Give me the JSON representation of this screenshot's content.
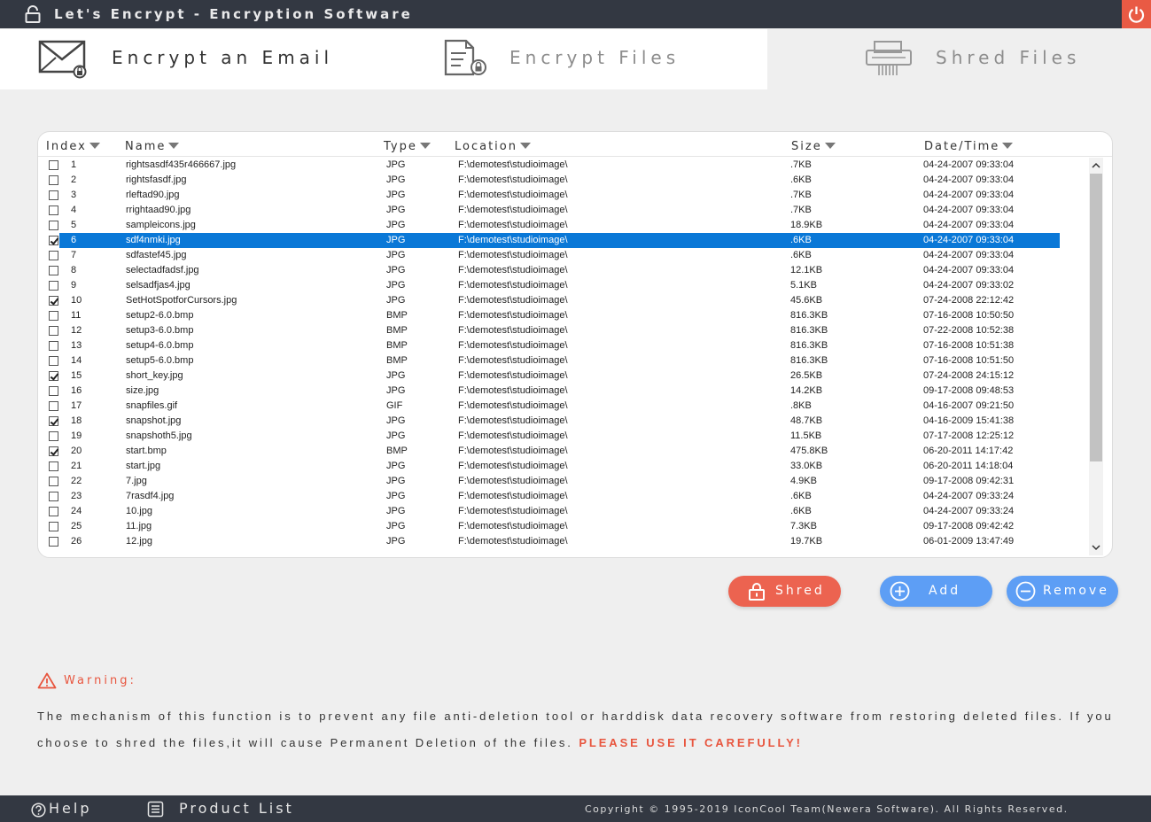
{
  "titlebar": {
    "title": "Let's Encrypt - Encryption Software"
  },
  "tabs": [
    {
      "label": "Encrypt an Email"
    },
    {
      "label": "Encrypt Files"
    },
    {
      "label": "Shred Files"
    }
  ],
  "table": {
    "columns": [
      "Index",
      "Name",
      "Type",
      "Location",
      "Size",
      "Date/Time"
    ],
    "rows": [
      {
        "checked": false,
        "selected": false,
        "index": "1",
        "name": "rightsasdf435r466667.jpg",
        "type": "JPG",
        "location": "F:\\demotest\\studioimage\\",
        "size": ".7KB",
        "date": "04-24-2007  09:33:04"
      },
      {
        "checked": false,
        "selected": false,
        "index": "2",
        "name": "rightsfasdf.jpg",
        "type": "JPG",
        "location": "F:\\demotest\\studioimage\\",
        "size": ".6KB",
        "date": "04-24-2007  09:33:04"
      },
      {
        "checked": false,
        "selected": false,
        "index": "3",
        "name": "rleftad90.jpg",
        "type": "JPG",
        "location": "F:\\demotest\\studioimage\\",
        "size": ".7KB",
        "date": "04-24-2007  09:33:04"
      },
      {
        "checked": false,
        "selected": false,
        "index": "4",
        "name": "rrightaad90.jpg",
        "type": "JPG",
        "location": "F:\\demotest\\studioimage\\",
        "size": ".7KB",
        "date": "04-24-2007  09:33:04"
      },
      {
        "checked": false,
        "selected": false,
        "index": "5",
        "name": "sampleicons.jpg",
        "type": "JPG",
        "location": "F:\\demotest\\studioimage\\",
        "size": "18.9KB",
        "date": "04-24-2007  09:33:04"
      },
      {
        "checked": true,
        "selected": true,
        "index": "6",
        "name": "sdf4nmki.jpg",
        "type": "JPG",
        "location": "F:\\demotest\\studioimage\\",
        "size": ".6KB",
        "date": "04-24-2007  09:33:04"
      },
      {
        "checked": false,
        "selected": false,
        "index": "7",
        "name": "sdfastef45.jpg",
        "type": "JPG",
        "location": "F:\\demotest\\studioimage\\",
        "size": ".6KB",
        "date": "04-24-2007  09:33:04"
      },
      {
        "checked": false,
        "selected": false,
        "index": "8",
        "name": "selectadfadsf.jpg",
        "type": "JPG",
        "location": "F:\\demotest\\studioimage\\",
        "size": "12.1KB",
        "date": "04-24-2007  09:33:04"
      },
      {
        "checked": false,
        "selected": false,
        "index": "9",
        "name": "selsadfjas4.jpg",
        "type": "JPG",
        "location": "F:\\demotest\\studioimage\\",
        "size": "5.1KB",
        "date": "04-24-2007  09:33:02"
      },
      {
        "checked": true,
        "selected": false,
        "index": "10",
        "name": "SetHotSpotforCursors.jpg",
        "type": "JPG",
        "location": "F:\\demotest\\studioimage\\",
        "size": "45.6KB",
        "date": "07-24-2008  22:12:42"
      },
      {
        "checked": false,
        "selected": false,
        "index": "11",
        "name": "setup2-6.0.bmp",
        "type": "BMP",
        "location": "F:\\demotest\\studioimage\\",
        "size": "816.3KB",
        "date": "07-16-2008  10:50:50"
      },
      {
        "checked": false,
        "selected": false,
        "index": "12",
        "name": "setup3-6.0.bmp",
        "type": "BMP",
        "location": "F:\\demotest\\studioimage\\",
        "size": "816.3KB",
        "date": "07-22-2008  10:52:38"
      },
      {
        "checked": false,
        "selected": false,
        "index": "13",
        "name": "setup4-6.0.bmp",
        "type": "BMP",
        "location": "F:\\demotest\\studioimage\\",
        "size": "816.3KB",
        "date": "07-16-2008  10:51:38"
      },
      {
        "checked": false,
        "selected": false,
        "index": "14",
        "name": "setup5-6.0.bmp",
        "type": "BMP",
        "location": "F:\\demotest\\studioimage\\",
        "size": "816.3KB",
        "date": "07-16-2008  10:51:50"
      },
      {
        "checked": true,
        "selected": false,
        "index": "15",
        "name": "short_key.jpg",
        "type": "JPG",
        "location": "F:\\demotest\\studioimage\\",
        "size": "26.5KB",
        "date": "07-24-2008  24:15:12"
      },
      {
        "checked": false,
        "selected": false,
        "index": "16",
        "name": "size.jpg",
        "type": "JPG",
        "location": "F:\\demotest\\studioimage\\",
        "size": "14.2KB",
        "date": "09-17-2008  09:48:53"
      },
      {
        "checked": false,
        "selected": false,
        "index": "17",
        "name": "snapfiles.gif",
        "type": "GIF",
        "location": "F:\\demotest\\studioimage\\",
        "size": ".8KB",
        "date": "04-16-2007  09:21:50"
      },
      {
        "checked": true,
        "selected": false,
        "index": "18",
        "name": "snapshot.jpg",
        "type": "JPG",
        "location": "F:\\demotest\\studioimage\\",
        "size": "48.7KB",
        "date": "04-16-2009  15:41:38"
      },
      {
        "checked": false,
        "selected": false,
        "index": "19",
        "name": "snapshoth5.jpg",
        "type": "JPG",
        "location": "F:\\demotest\\studioimage\\",
        "size": "11.5KB",
        "date": "07-17-2008  12:25:12"
      },
      {
        "checked": true,
        "selected": false,
        "index": "20",
        "name": "start.bmp",
        "type": "BMP",
        "location": "F:\\demotest\\studioimage\\",
        "size": "475.8KB",
        "date": "06-20-2011  14:17:42"
      },
      {
        "checked": false,
        "selected": false,
        "index": "21",
        "name": "start.jpg",
        "type": "JPG",
        "location": "F:\\demotest\\studioimage\\",
        "size": "33.0KB",
        "date": "06-20-2011  14:18:04"
      },
      {
        "checked": false,
        "selected": false,
        "index": "22",
        "name": "7.jpg",
        "type": "JPG",
        "location": "F:\\demotest\\studioimage\\",
        "size": "4.9KB",
        "date": "09-17-2008  09:42:31"
      },
      {
        "checked": false,
        "selected": false,
        "index": "23",
        "name": "7rasdf4.jpg",
        "type": "JPG",
        "location": "F:\\demotest\\studioimage\\",
        "size": ".6KB",
        "date": "04-24-2007  09:33:24"
      },
      {
        "checked": false,
        "selected": false,
        "index": "24",
        "name": "10.jpg",
        "type": "JPG",
        "location": "F:\\demotest\\studioimage\\",
        "size": ".6KB",
        "date": "04-24-2007  09:33:24"
      },
      {
        "checked": false,
        "selected": false,
        "index": "25",
        "name": "11.jpg",
        "type": "JPG",
        "location": "F:\\demotest\\studioimage\\",
        "size": "7.3KB",
        "date": "09-17-2008  09:42:42"
      },
      {
        "checked": false,
        "selected": false,
        "index": "26",
        "name": "12.jpg",
        "type": "JPG",
        "location": "F:\\demotest\\studioimage\\",
        "size": "19.7KB",
        "date": "06-01-2009  13:47:49"
      }
    ]
  },
  "buttons": {
    "shred": "Shred",
    "add": "Add",
    "remove": "Remove"
  },
  "warning": {
    "title": "Warning:",
    "text": "The mechanism of this function is to prevent any file anti-deletion tool or harddisk data recovery software from restoring deleted files. If you choose to shred the files,it will cause Permanent Deletion of the files.",
    "emphasis": "PLEASE USE IT CAREFULLY!"
  },
  "footer": {
    "help": "Help",
    "product_list": "Product List",
    "copyright": "Copyright © 1995-2019 IconCool Team(Newera Software). All Rights Reserved."
  },
  "colors": {
    "titlebar": "#333842",
    "accent_red": "#ec6350",
    "accent_blue": "#5d9ef5",
    "selection": "#0a78d7"
  }
}
